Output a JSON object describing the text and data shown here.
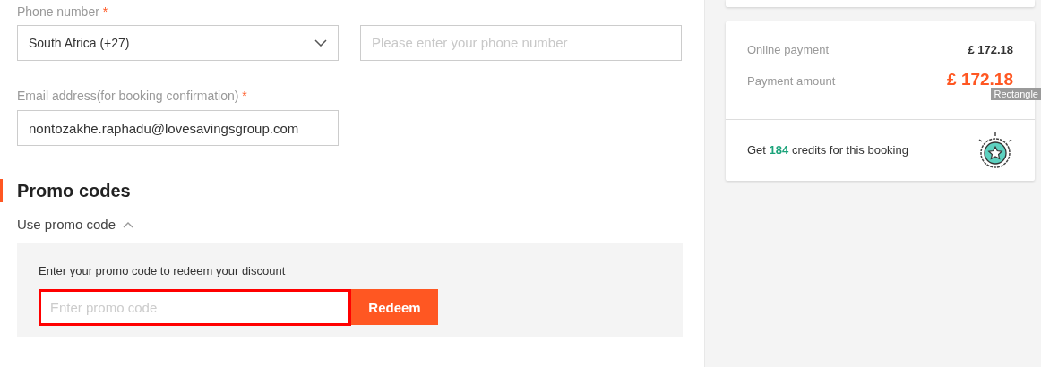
{
  "phone": {
    "label": "Phone number",
    "required_mark": "*",
    "country": "South Africa (+27)",
    "placeholder": "Please enter your phone number"
  },
  "email": {
    "label": "Email address(for booking confirmation)",
    "required_mark": "*",
    "value": "nontozakhe.raphadu@lovesavingsgroup.com"
  },
  "promo": {
    "title": "Promo codes",
    "toggle": "Use promo code",
    "expanded": true,
    "hint": "Enter your promo code to redeem your discount",
    "placeholder": "Enter promo code",
    "button": "Redeem"
  },
  "summary": {
    "rows": [
      {
        "label": "Online payment",
        "value": "£ 172.18",
        "kind": "normal"
      },
      {
        "label": "Payment amount",
        "value": "£ 172.18",
        "kind": "total"
      }
    ],
    "credits": "Get **184** credits for this booking",
    "tooltip": "Rectangle"
  }
}
